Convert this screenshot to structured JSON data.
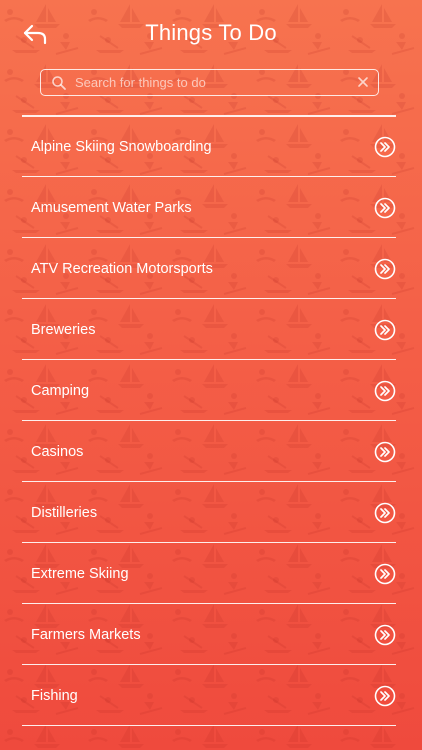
{
  "header": {
    "title": "Things To Do",
    "back_icon": "back-arrow-icon"
  },
  "search": {
    "placeholder": "Search for things to do",
    "value": "",
    "search_icon": "search-icon",
    "clear_icon": "clear-icon"
  },
  "list": {
    "items": [
      {
        "label": "Alpine Skiing Snowboarding",
        "icon": "chevron-double-right-circle-icon"
      },
      {
        "label": "Amusement Water Parks",
        "icon": "chevron-double-right-circle-icon"
      },
      {
        "label": "ATV Recreation Motorsports",
        "icon": "chevron-double-right-circle-icon"
      },
      {
        "label": "Breweries",
        "icon": "chevron-double-right-circle-icon"
      },
      {
        "label": "Camping",
        "icon": "chevron-double-right-circle-icon"
      },
      {
        "label": "Casinos",
        "icon": "chevron-double-right-circle-icon"
      },
      {
        "label": "Distilleries",
        "icon": "chevron-double-right-circle-icon"
      },
      {
        "label": "Extreme Skiing",
        "icon": "chevron-double-right-circle-icon"
      },
      {
        "label": "Farmers Markets",
        "icon": "chevron-double-right-circle-icon"
      },
      {
        "label": "Fishing",
        "icon": "chevron-double-right-circle-icon"
      }
    ]
  },
  "colors": {
    "background_top": "#f7734f",
    "background_bottom": "#ef4a3d",
    "foreground": "#ffffff"
  }
}
